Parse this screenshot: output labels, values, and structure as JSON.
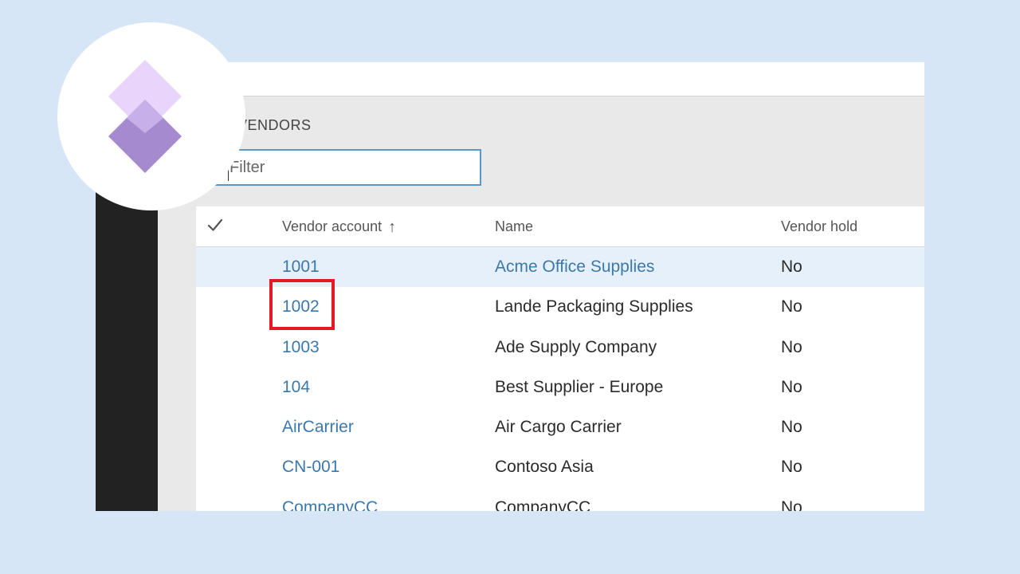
{
  "page": {
    "title": "VENDORS"
  },
  "filter": {
    "placeholder": "Filter"
  },
  "grid": {
    "columns": {
      "select": "",
      "account": "Vendor account",
      "name": "Name",
      "hold": "Vendor hold"
    },
    "sort_indicator": "↑",
    "rows": [
      {
        "account": "1001",
        "name": "Acme Office Supplies",
        "hold": "No",
        "selected": true
      },
      {
        "account": "1002",
        "name": "Lande Packaging Supplies",
        "hold": "No",
        "selected": false
      },
      {
        "account": "1003",
        "name": "Ade Supply Company",
        "hold": "No",
        "selected": false
      },
      {
        "account": "104",
        "name": "Best Supplier - Europe",
        "hold": "No",
        "selected": false
      },
      {
        "account": "AirCarrier",
        "name": "Air Cargo Carrier",
        "hold": "No",
        "selected": false
      },
      {
        "account": "CN-001",
        "name": "Contoso Asia",
        "hold": "No",
        "selected": false
      },
      {
        "account": "CompanyCC",
        "name": "CompanyCC",
        "hold": "No",
        "selected": false
      }
    ]
  },
  "icons": {
    "select_all": "checkmark-icon",
    "logo": "power-apps-logo-icon"
  },
  "colors": {
    "background": "#d6e6f7",
    "link": "#3b78ab",
    "selected_row": "#e6f0fa",
    "highlight": "#e21b22",
    "filter_border": "#5a98c9",
    "logo_light": "#e9d5fb",
    "logo_dark": "#a58ad0"
  }
}
